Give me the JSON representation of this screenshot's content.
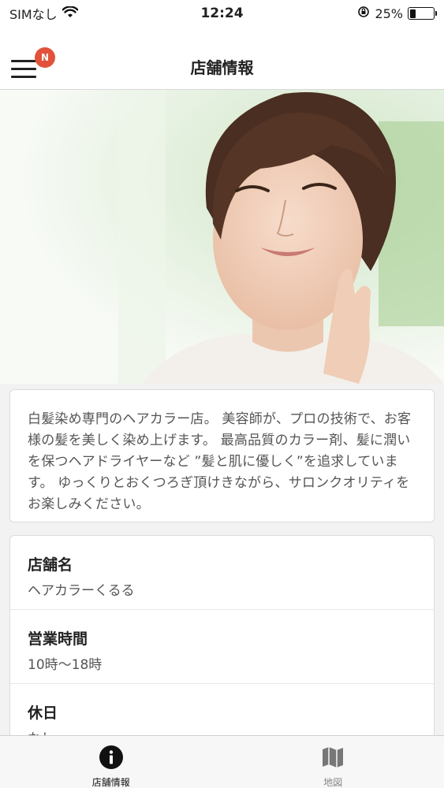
{
  "status_bar": {
    "carrier": "SIMなし",
    "time": "12:24",
    "battery_percent": "25%",
    "battery_level": 0.25
  },
  "nav": {
    "title": "店舗情報",
    "badge": "N",
    "badge_color": "#e2523a"
  },
  "hero": {
    "image": "woman-portrait-photo"
  },
  "description": "白髪染め専門のヘアカラー店。 美容師が、プロの技術で、お客様の髪を美しく染め上げます。 最高品質のカラー剤、髪に潤いを保つヘアドライヤーなど ”髪と肌に優しく”を追求しています。 ゆっくりとおくつろぎ頂けきながら、サロンクオリティをお楽しみください。",
  "info": [
    {
      "label": "店舗名",
      "value": "ヘアカラーくるる"
    },
    {
      "label": "営業時間",
      "value": "10時〜18時"
    },
    {
      "label": "休日",
      "value": "なし"
    }
  ],
  "tabs": [
    {
      "label": "店舗情報",
      "icon": "info-icon",
      "active": true
    },
    {
      "label": "地図",
      "icon": "map-icon",
      "active": false
    }
  ]
}
